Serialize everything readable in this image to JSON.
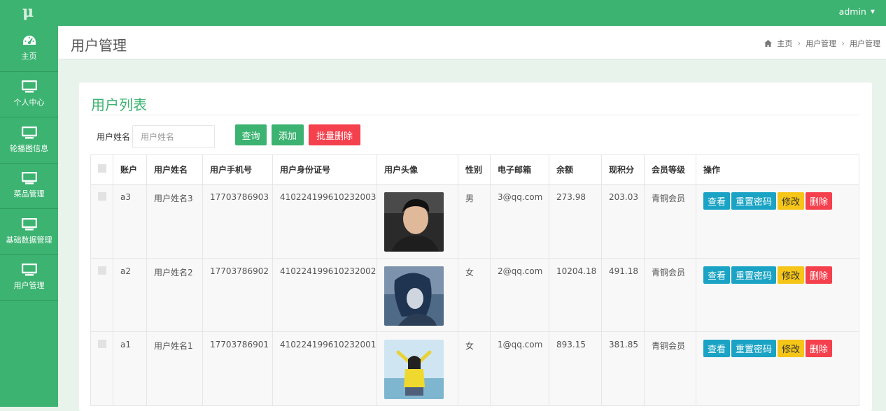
{
  "app": {
    "logo": "μ"
  },
  "topbar": {
    "user": "admin"
  },
  "sidebar": {
    "items": [
      {
        "label": "主页",
        "icon": "dashboard-icon"
      },
      {
        "label": "个人中心",
        "icon": "monitor-icon"
      },
      {
        "label": "轮播图信息",
        "icon": "monitor-icon"
      },
      {
        "label": "菜品管理",
        "icon": "monitor-icon"
      },
      {
        "label": "基础数据管理",
        "icon": "monitor-icon"
      },
      {
        "label": "用户管理",
        "icon": "monitor-icon"
      }
    ]
  },
  "header": {
    "title": "用户管理",
    "breadcrumb": [
      "主页",
      "用户管理",
      "用户管理"
    ]
  },
  "panel": {
    "title": "用户列表",
    "search_label": "用户姓名",
    "search_placeholder": "用户姓名",
    "query_label": "查询",
    "add_label": "添加",
    "batch_delete_label": "批量删除"
  },
  "table": {
    "columns": [
      "账户",
      "用户姓名",
      "用户手机号",
      "用户身份证号",
      "用户头像",
      "性别",
      "电子邮箱",
      "余额",
      "现积分",
      "会员等级",
      "操作"
    ],
    "rows": [
      {
        "account": "a3",
        "name": "用户姓名3",
        "phone": "17703786903",
        "idcard": "410224199610232003",
        "gender": "男",
        "email": "3@qq.com",
        "balance": "273.98",
        "points": "203.03",
        "level": "青铜会员"
      },
      {
        "account": "a2",
        "name": "用户姓名2",
        "phone": "17703786902",
        "idcard": "410224199610232002",
        "gender": "女",
        "email": "2@qq.com",
        "balance": "10204.18",
        "points": "491.18",
        "level": "青铜会员"
      },
      {
        "account": "a1",
        "name": "用户姓名1",
        "phone": "17703786901",
        "idcard": "410224199610232001",
        "gender": "女",
        "email": "1@qq.com",
        "balance": "893.15",
        "points": "381.85",
        "level": "青铜会员"
      }
    ],
    "ops": {
      "view": "查看",
      "reset": "重置密码",
      "edit": "修改",
      "delete": "删除"
    }
  },
  "colors": {
    "brand": "#3cb371",
    "danger": "#f5404d",
    "info": "#1aa3c4",
    "warning": "#f5c518"
  }
}
